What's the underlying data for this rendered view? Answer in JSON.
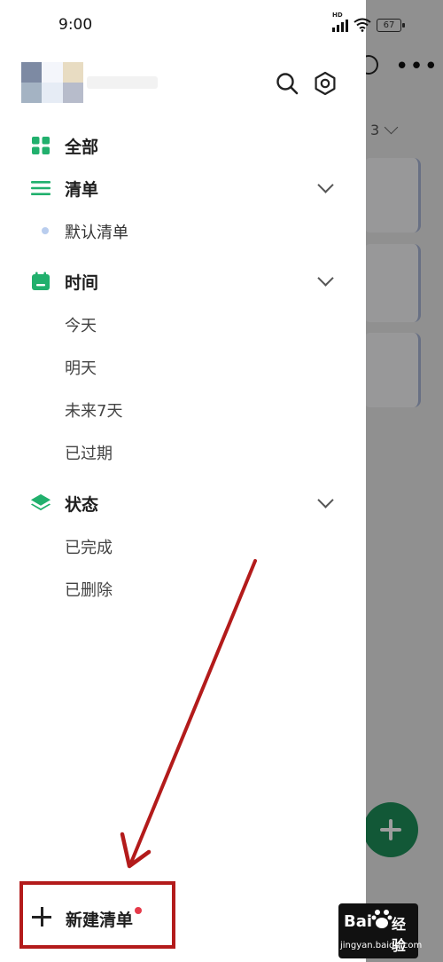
{
  "status_bar": {
    "time": "9:00",
    "signal_label": "HD",
    "battery": "67"
  },
  "background": {
    "count": "3"
  },
  "drawer": {
    "nav": [
      {
        "label": "全部"
      },
      {
        "label": "清单"
      },
      {
        "label": "默认清单"
      },
      {
        "label": "时间"
      },
      {
        "label": "今天"
      },
      {
        "label": "明天"
      },
      {
        "label": "未来7天"
      },
      {
        "label": "已过期"
      },
      {
        "label": "状态"
      },
      {
        "label": "已完成"
      },
      {
        "label": "已删除"
      }
    ],
    "new_list_label": "新建清单"
  },
  "watermark": {
    "brand": "Bai",
    "suffix": "经验",
    "url": "jingyan.baidu.com"
  },
  "colors": {
    "accent": "#21b06d",
    "annotation": "#b31b1b",
    "list_dot": "#b9cdee"
  }
}
